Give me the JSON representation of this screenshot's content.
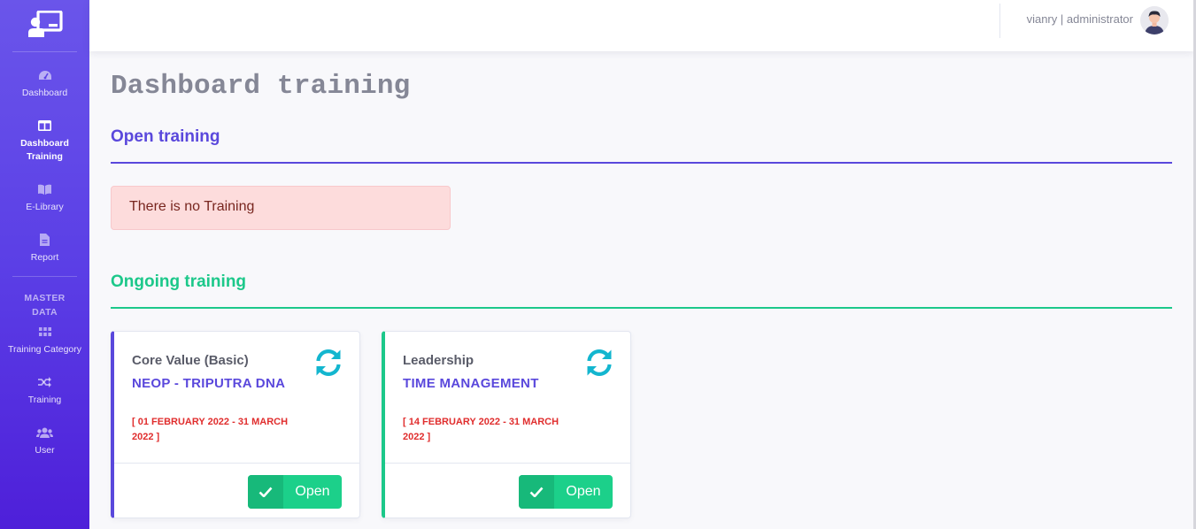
{
  "sidebar": {
    "brand_icon": "chalkboard-teacher-icon",
    "items": [
      {
        "label": "Dashboard",
        "icon": "tachometer-icon"
      },
      {
        "label": "Dashboard Training",
        "icon": "columns-icon"
      },
      {
        "label": "E-Library",
        "icon": "book-open-icon"
      },
      {
        "label": "Report",
        "icon": "file-icon"
      }
    ],
    "master_heading": "MASTER DATA",
    "master_items": [
      {
        "label": "Training Category",
        "icon": "th-icon"
      },
      {
        "label": "Training",
        "icon": "random-icon"
      },
      {
        "label": "User",
        "icon": "users-icon"
      }
    ],
    "colors": {
      "gradient_top": "#6a55ea",
      "gradient_bottom": "#4e1fd9"
    }
  },
  "topbar": {
    "user_label": "vianry | administrator",
    "avatar_icon": "user-avatar-icon"
  },
  "main": {
    "title": "Dashboard training",
    "open_section": {
      "title": "Open training",
      "empty_message": "There is no Training",
      "accent": "#5a48dc"
    },
    "ongoing_section": {
      "title": "Ongoing training",
      "accent": "#1cc88a",
      "cards": [
        {
          "category": "Core Value (Basic)",
          "name": "NEOP - TRIPUTRA DNA",
          "date_range": "[ 01 FEBRUARY 2022 - 31 MARCH 2022 ]",
          "status_icon": "sync-icon",
          "button_label": "Open",
          "button_icon": "check-icon"
        },
        {
          "category": "Leadership",
          "name": "TIME MANAGEMENT",
          "date_range": "[ 14 FEBRUARY 2022 - 31 MARCH 2022 ]",
          "status_icon": "sync-icon",
          "button_label": "Open",
          "button_icon": "check-icon"
        }
      ]
    }
  }
}
